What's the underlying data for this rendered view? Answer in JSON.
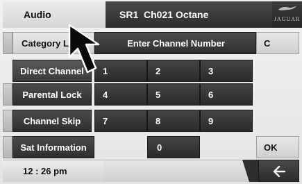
{
  "header": {
    "audio_label": "Audio",
    "station": "SR1  Ch021 Octane",
    "brand_text": "JAGUAR",
    "brand_icon": "jaguar-leaper-logo"
  },
  "menu": {
    "category_label": "Category L",
    "items": [
      {
        "label": "Direct Channel"
      },
      {
        "label": "Parental Lock"
      },
      {
        "label": "Channel Skip"
      },
      {
        "label": "Sat Information"
      }
    ]
  },
  "entry": {
    "prompt": "Enter Channel Number"
  },
  "actions": {
    "clear_label": "C",
    "ok_label": "OK",
    "back_icon": "left-arrow"
  },
  "keypad": {
    "keys": [
      "1",
      "2",
      "3",
      "4",
      "5",
      "6",
      "7",
      "8",
      "9",
      "0"
    ]
  },
  "footer": {
    "time": "12 : 26 pm"
  },
  "colors": {
    "dark_button": "#333333",
    "light_surface": "#e6e6e6",
    "text_light": "#ffffff"
  }
}
